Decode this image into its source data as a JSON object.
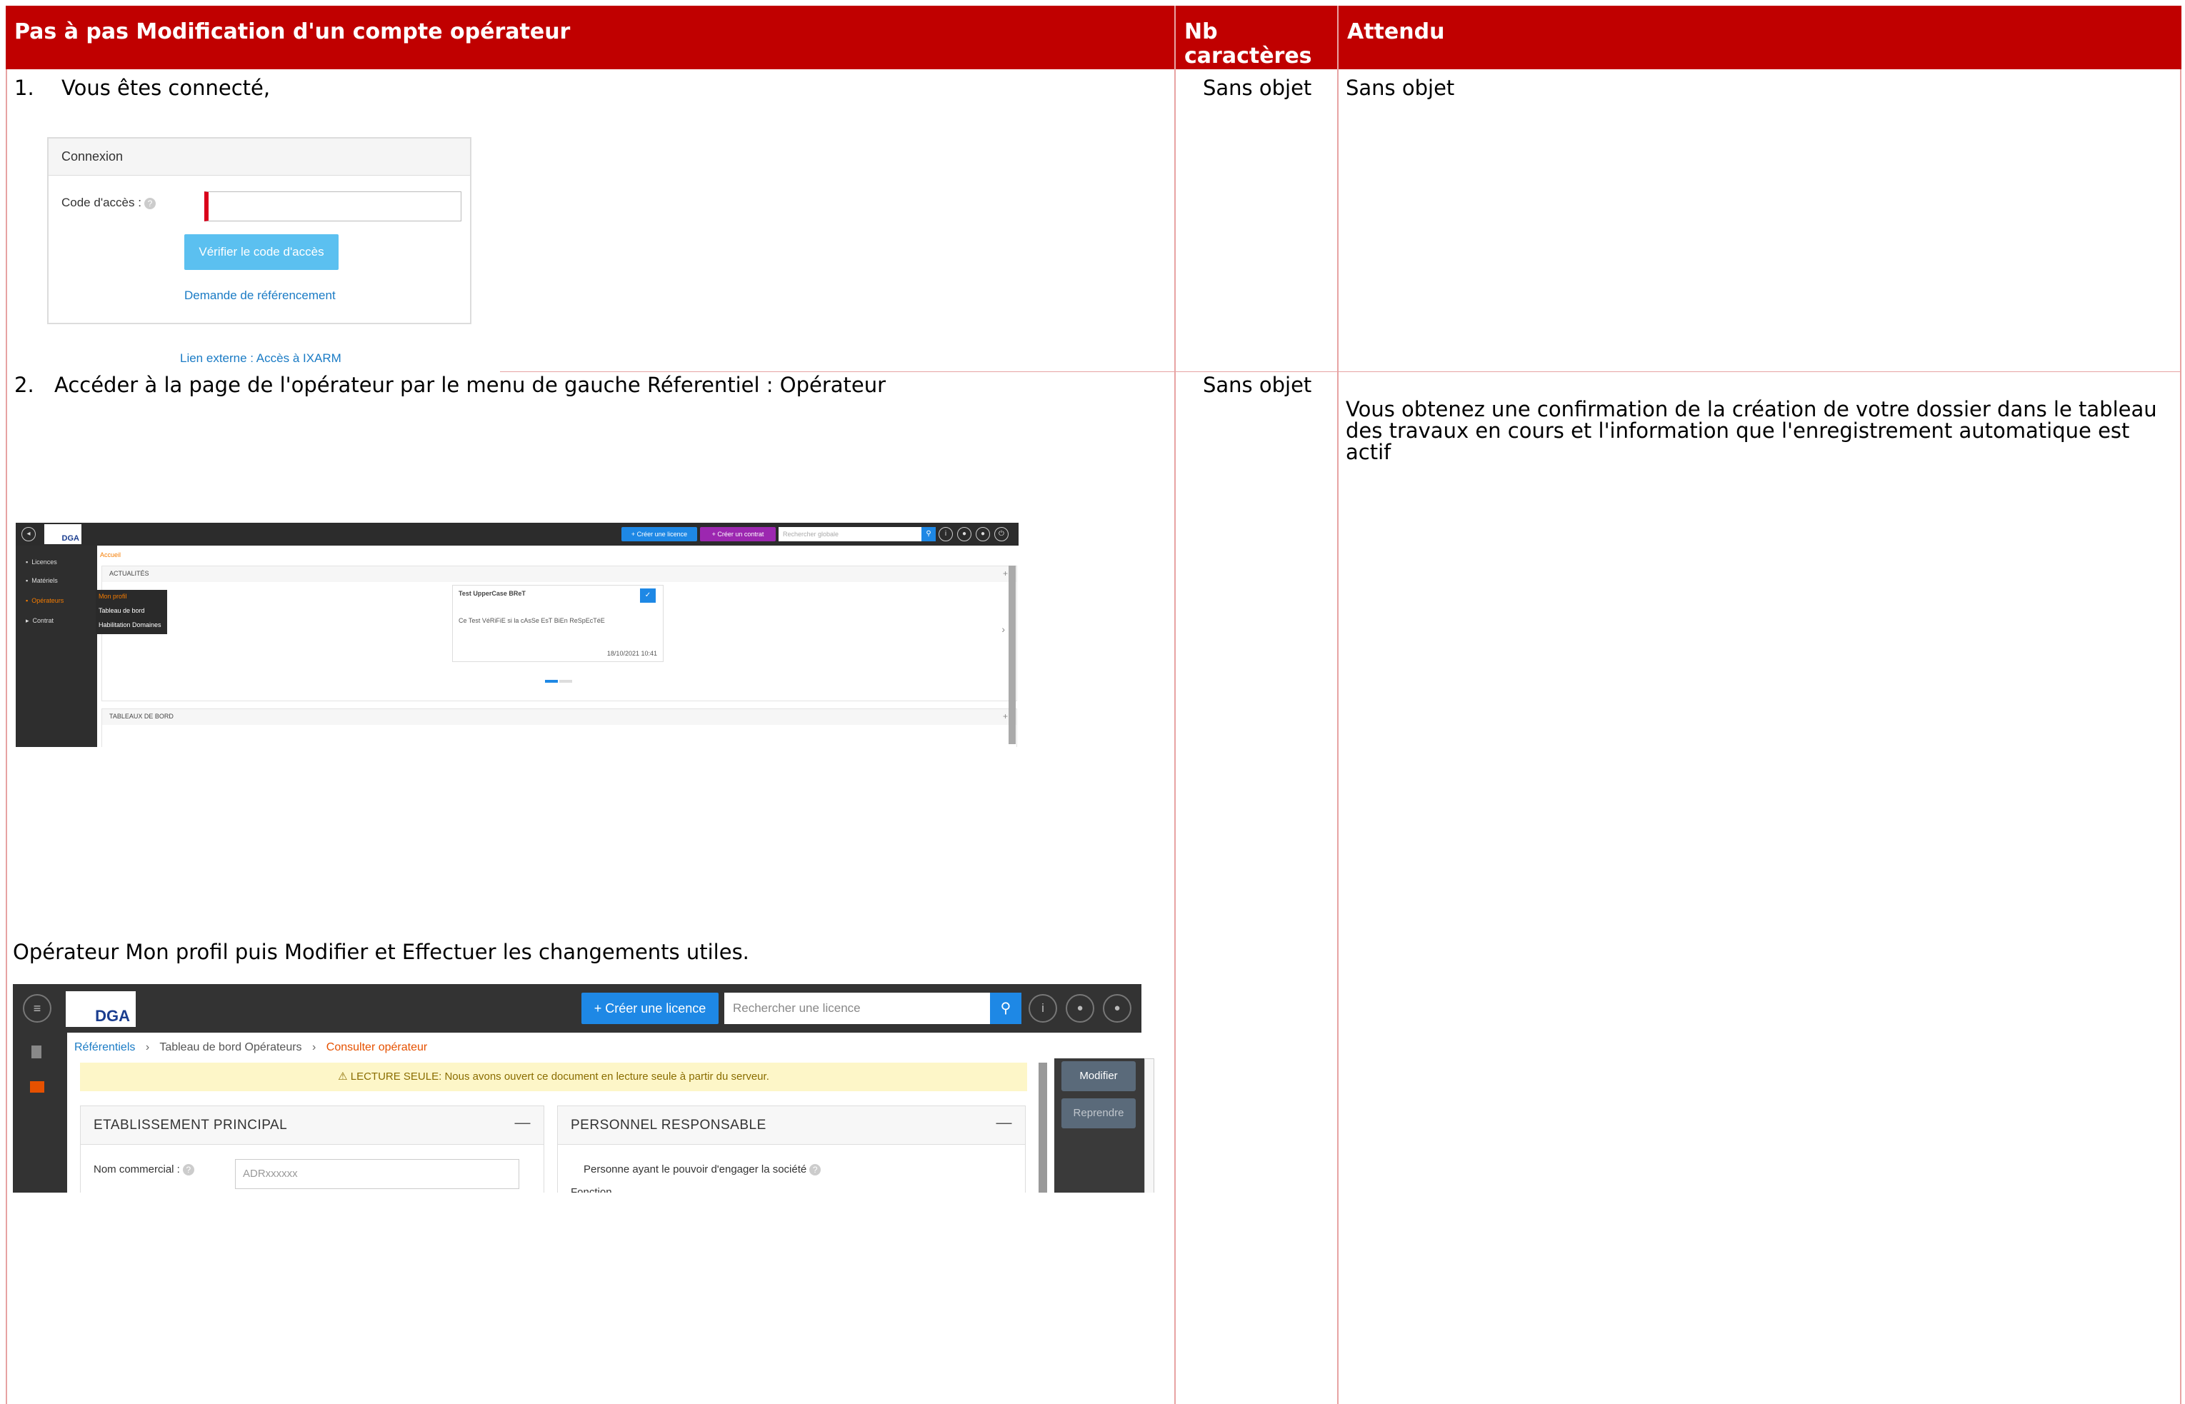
{
  "table": {
    "headers": {
      "step": "Pas à pas Modification d'un compte opérateur",
      "nb_chars": "Nb caractères",
      "expected": "Attendu"
    },
    "rows": [
      {
        "number": "1.",
        "step_text": "Vous êtes connecté,",
        "nb_chars": "Sans objet",
        "expected": "Sans objet"
      },
      {
        "number": "2.",
        "step_text": "Accéder à la page de l'opérateur par le menu de gauche Réferentiel : Opérateur",
        "step_text_2": "Opérateur Mon profil puis Modifier et Effectuer les changements utiles.",
        "nb_chars": "Sans objet",
        "expected": "Vous obtenez une confirmation de la création de votre dossier dans le tableau des travaux en cours et l'information que l'enregistrement automatique est actif"
      }
    ]
  },
  "login_screenshot": {
    "title": "Connexion",
    "code_label": "Code d'accès :",
    "verify_button": "Vérifier le code d'accès",
    "referencing_link": "Demande de référencement",
    "external_link": "Lien externe : Accès à IXARM"
  },
  "dashboard_screenshot": {
    "logo_text": "DGA",
    "create_licence": "+ Créer une licence",
    "create_contract": "+ Créer un contrat",
    "search_placeholder": "Rechercher globale",
    "nav": [
      "Licences",
      "Matériels",
      "Opérateurs",
      "Contrat"
    ],
    "submenu": [
      "Mon profil",
      "Tableau de bord",
      "Habilitation Domaines"
    ],
    "breadcrumb": "Accueil",
    "news_title": "ACTUALITÉS",
    "news_card_title": "Test UpperCase BReT",
    "news_card_body": "Ce Test VéRiFiE si la cAsSe EsT BiEn ReSpEcTéE",
    "news_card_date": "18/10/2021 10:41",
    "dashboards_title": "TABLEAUX DE BORD"
  },
  "operator_screenshot": {
    "logo_text": "DGA",
    "create_licence": "+ Créer une licence",
    "search_placeholder": "Rechercher une licence",
    "breadcrumb": [
      "Référentiels",
      "Tableau de bord Opérateurs",
      "Consulter opérateur"
    ],
    "readonly_notice": "⚠ LECTURE SEULE: Nous avons ouvert ce document en lecture seule à partir du serveur.",
    "modify_button": "Modifier",
    "resume_button": "Reprendre",
    "panel_left_title": "ETABLISSEMENT PRINCIPAL",
    "commercial_name_label": "Nom commercial :",
    "commercial_name_value": "ADRxxxxxx",
    "panel_right_title": "PERSONNEL RESPONSABLE",
    "responsible_text": "Personne ayant le pouvoir d'engager la société",
    "function_label": "Fonction"
  },
  "colors": {
    "header_red": "#c00000",
    "grid_pink": "#e7a3a3"
  }
}
